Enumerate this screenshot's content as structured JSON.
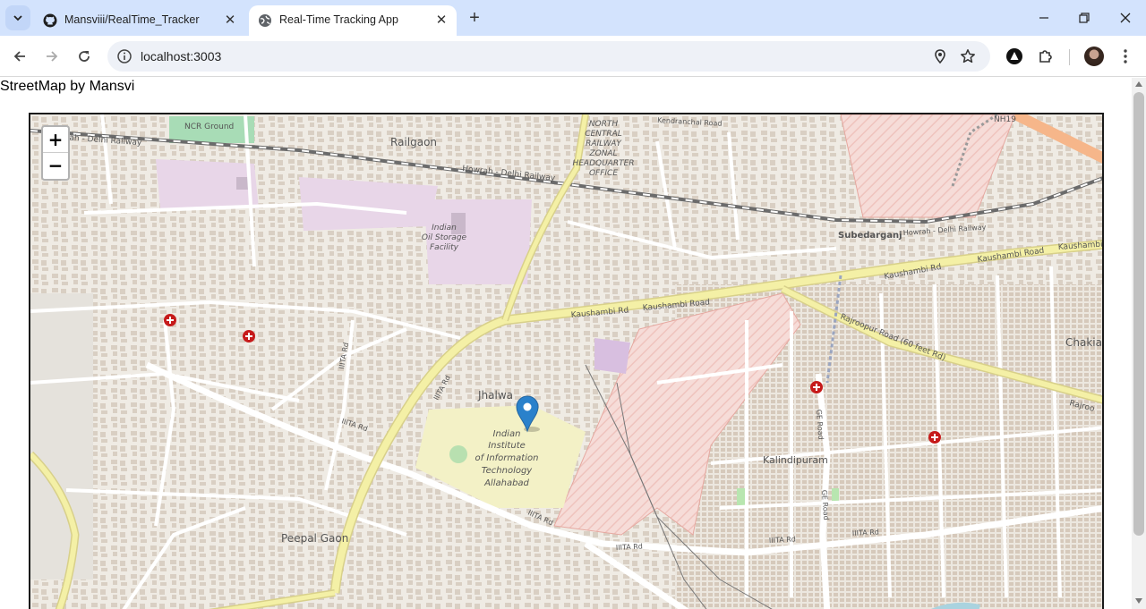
{
  "tabs": [
    {
      "title": "Mansviii/RealTime_Tracker",
      "icon": "github-icon",
      "active": false
    },
    {
      "title": "Real-Time Tracking App",
      "icon": "globe-icon",
      "active": true
    }
  ],
  "address_bar": {
    "url": "localhost:3003"
  },
  "page": {
    "title": "StreetMap by Mansvi"
  },
  "map": {
    "zoom_in_label": "+",
    "zoom_out_label": "−",
    "labels": {
      "ncr_ground": "NCR Ground",
      "howrah_delhi_railway_1": "Howrah - Delhi Railway",
      "railgaon": "Railgaon",
      "howrah_delhi_railway_2": "Howrah - Delhi Railway",
      "ncr_hq_1": "NORTH",
      "ncr_hq_2": "CENTRAL",
      "ncr_hq_3": "RAILWAY",
      "ncr_hq_4": "ZONAL",
      "ncr_hq_5": "HEADQUARTER",
      "ncr_hq_6": "OFFICE",
      "kendranchal_road": "Kendranchal Road",
      "nh19": "NH19",
      "subedarganj": "Subedarganj",
      "howrah_delhi_railway_3": "Howrah - Delhi Railway",
      "iocl_1": "Indian",
      "iocl_2": "Oil Storage",
      "iocl_3": "Facility",
      "kaushambi_rd_1": "Kaushambi Rd",
      "kaushambi_road_1": "Kaushambi Road",
      "kaushambi_rd_2": "Kaushambi Rd",
      "kaushambi_road_2": "Kaushambi Road",
      "kaushambi_3": "Kaushambi",
      "rajroopur_road": "Rajroopur Road (60 feet Rd)",
      "chakia": "Chakia",
      "rajroo": "Rajroo",
      "iiita_rd_1": "IIITA Rd",
      "iiita_rd_2": "IIITA Rd",
      "iiita_rd_3": "IIITA Rd",
      "iiita_rd_4": "IIITA Rd",
      "iiita_rd_5": "IIITA Rd",
      "iiita_rd_6": "IIITA Rd",
      "iiita_rd_7": "IIITA Rd",
      "jhalwa": "Jhalwa",
      "iiit_1": "Indian",
      "iiit_2": "Institute",
      "iiit_3": "of Information",
      "iiit_4": "Technology",
      "iiit_5": "Allahabad",
      "ge_road_1": "GE Road",
      "ge_road_2": "GE Road",
      "kalindipuram": "Kalindipuram",
      "peepal_gaon": "Peepal Gaon"
    },
    "marker_icon": "map-pin-icon",
    "hospital_icon": "hospital-icon"
  }
}
